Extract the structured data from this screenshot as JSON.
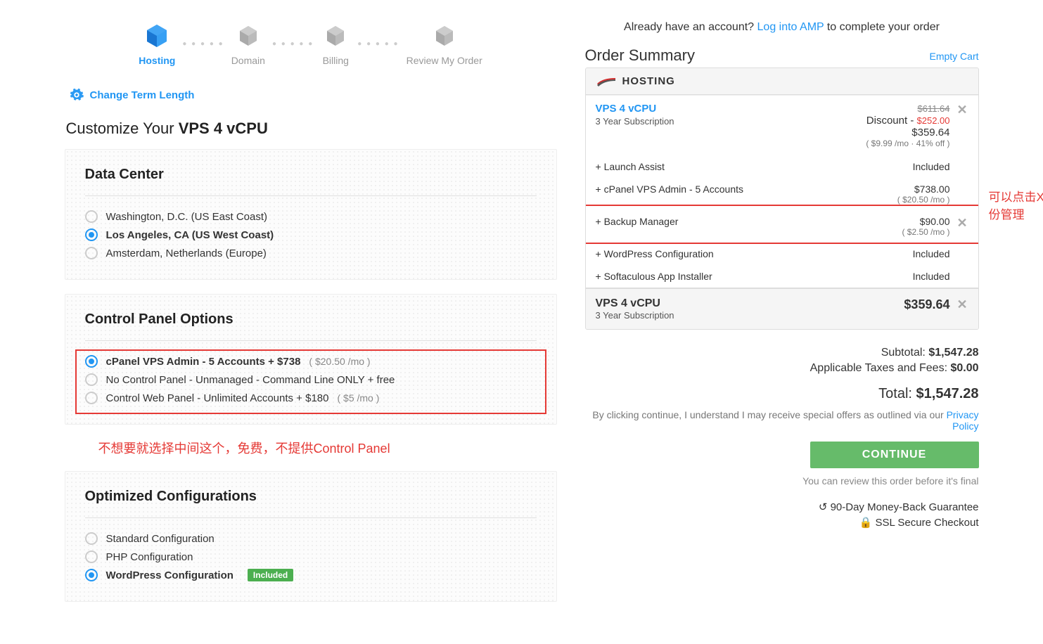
{
  "steps": [
    "Hosting",
    "Domain",
    "Billing",
    "Review My Order"
  ],
  "activeStep": 0,
  "changeTerm": "Change Term Length",
  "customize": {
    "prefix": "Customize Your ",
    "plan": "VPS 4 vCPU"
  },
  "dataCenter": {
    "title": "Data Center",
    "options": [
      {
        "label": "Washington, D.C. (US East Coast)",
        "selected": false
      },
      {
        "label": "Los Angeles, CA (US West Coast)",
        "selected": true
      },
      {
        "label": "Amsterdam, Netherlands (Europe)",
        "selected": false
      }
    ]
  },
  "controlPanel": {
    "title": "Control Panel Options",
    "options": [
      {
        "label": "cPanel VPS Admin - 5 Accounts + $738",
        "sub": "( $20.50 /mo )",
        "selected": true
      },
      {
        "label": "No Control Panel - Unmanaged - Command Line ONLY + free",
        "sub": "",
        "selected": false
      },
      {
        "label": "Control Web Panel - Unlimited Accounts + $180",
        "sub": "( $5 /mo )",
        "selected": false
      }
    ],
    "note": "不想要就选择中间这个，免费，不提供Control Panel"
  },
  "optimized": {
    "title": "Optimized Configurations",
    "options": [
      {
        "label": "Standard Configuration",
        "selected": false,
        "badge": ""
      },
      {
        "label": "PHP Configuration",
        "selected": false,
        "badge": ""
      },
      {
        "label": "WordPress Configuration",
        "selected": true,
        "badge": "Included"
      }
    ]
  },
  "accountNote": {
    "pre": "Already have an account? ",
    "link": "Log into AMP",
    "post": " to complete your order"
  },
  "order": {
    "title": "Order Summary",
    "empty": "Empty Cart",
    "category": "HOSTING",
    "product": {
      "name": "VPS 4 vCPU",
      "term": "3 Year Subscription",
      "original": "$611.64",
      "discountLabel": "Discount - ",
      "discount": "$252.00",
      "price": "$359.64",
      "rate": "( $9.99 /mo · 41% off )"
    },
    "addons": [
      {
        "name": "+ Launch Assist",
        "price": "Included",
        "rate": "",
        "x": false
      },
      {
        "name": "+ cPanel VPS Admin - 5 Accounts",
        "price": "$738.00",
        "rate": "( $20.50 /mo )",
        "x": false
      },
      {
        "name": "+ Backup Manager",
        "price": "$90.00",
        "rate": "( $2.50 /mo )",
        "x": true,
        "highlight": true
      },
      {
        "name": "+ WordPress Configuration",
        "price": "Included",
        "rate": "",
        "x": false
      },
      {
        "name": "+ Softaculous App Installer",
        "price": "Included",
        "rate": "",
        "x": false
      }
    ],
    "sideNote": "可以点击X去掉备份管理",
    "bottom": {
      "name": "VPS 4 vCPU",
      "term": "3 Year Subscription",
      "price": "$359.64"
    },
    "subtotalLabel": "Subtotal: ",
    "subtotal": "$1,547.28",
    "taxLabel": "Applicable Taxes and Fees: ",
    "tax": "$0.00",
    "totalLabel": "Total: ",
    "total": "$1,547.28",
    "disclaimerPre": "By clicking continue, I understand I may receive special offers as outlined via our ",
    "disclaimerLink": "Privacy Policy",
    "continue": "CONTINUE",
    "reviewNote": "You can review this order before it's final",
    "g1": "90-Day Money-Back Guarantee",
    "g2": "SSL Secure Checkout"
  }
}
